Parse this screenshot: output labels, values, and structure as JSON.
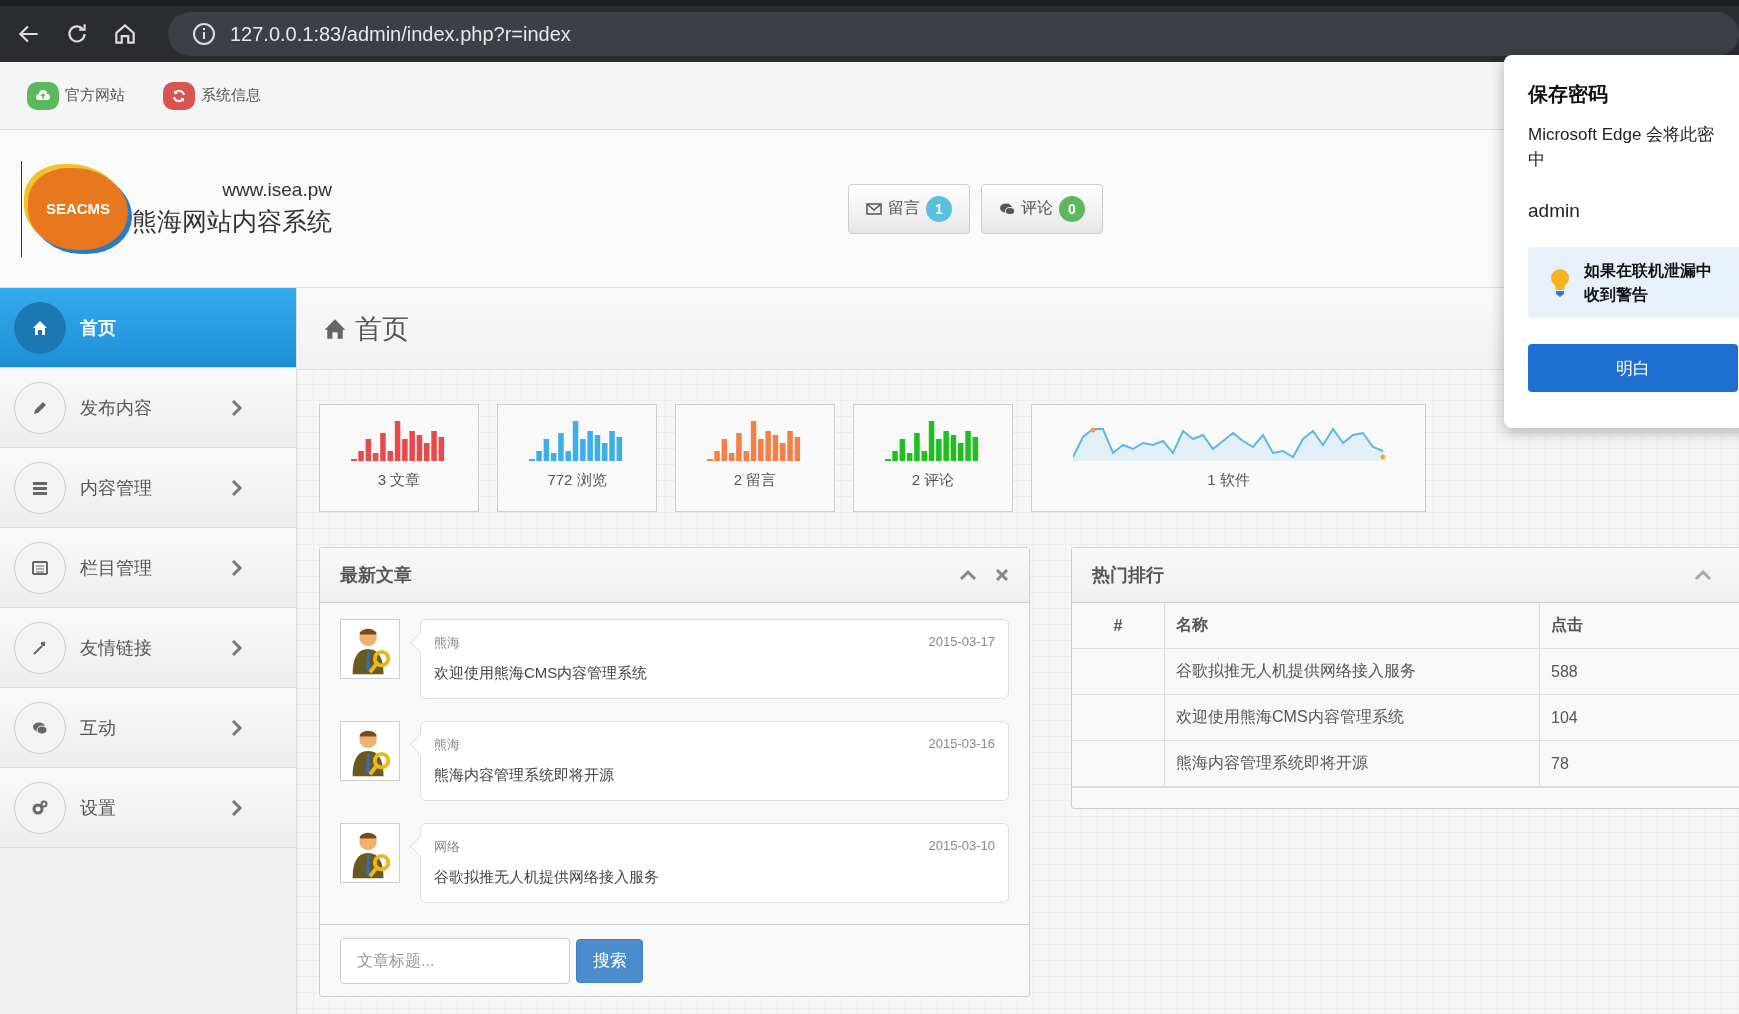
{
  "browser": {
    "url": "127.0.0.1:83/admin/index.php?r=index"
  },
  "top_nav": [
    {
      "label": "官方网站",
      "color": "#5cb85c"
    },
    {
      "label": "系统信息",
      "color": "#d9534f"
    }
  ],
  "header": {
    "logo_text": "SEACMS",
    "site_url": "www.isea.pw",
    "site_name": "熊海网站内容系统",
    "buttons": [
      {
        "label": "留言",
        "count": "1",
        "color": "#5bc0de"
      },
      {
        "label": "评论",
        "count": "0",
        "color": "#5cb85c"
      }
    ]
  },
  "sidebar": {
    "items": [
      {
        "label": "首页",
        "selected": true
      },
      {
        "label": "发布内容",
        "selected": false
      },
      {
        "label": "内容管理",
        "selected": false
      },
      {
        "label": "栏目管理",
        "selected": false
      },
      {
        "label": "友情链接",
        "selected": false
      },
      {
        "label": "互动",
        "selected": false
      },
      {
        "label": "设置",
        "selected": false
      }
    ]
  },
  "page_title": "首页",
  "stats": [
    {
      "kind": "bars",
      "label": "3 文章",
      "color": "#e84a4a"
    },
    {
      "kind": "bars",
      "label": "772 浏览",
      "color": "#3daee9"
    },
    {
      "kind": "bars",
      "label": "2 留言",
      "color": "#f57f46"
    },
    {
      "kind": "bars",
      "label": "2 评论",
      "color": "#1fbf1f"
    },
    {
      "kind": "line",
      "label": "1 软件",
      "color": "#5bb8e6"
    }
  ],
  "latest_articles": {
    "title": "最新文章",
    "items": [
      {
        "author": "熊海",
        "date": "2015-03-17",
        "title": "欢迎使用熊海CMS内容管理系统"
      },
      {
        "author": "熊海",
        "date": "2015-03-16",
        "title": "熊海内容管理系统即将开源"
      },
      {
        "author": "网络",
        "date": "2015-03-10",
        "title": "谷歌拟推无人机提供网络接入服务"
      }
    ],
    "search": {
      "placeholder": "文章标题...",
      "button": "搜索"
    }
  },
  "ranking": {
    "title": "热门排行",
    "columns": [
      "#",
      "名称",
      "点击"
    ],
    "rows": [
      {
        "name": "谷歌拟推无人机提供网络接入服务",
        "hits": "588"
      },
      {
        "name": "欢迎使用熊海CMS内容管理系统",
        "hits": "104"
      },
      {
        "name": "熊海内容管理系统即将开源",
        "hits": "78"
      }
    ]
  },
  "password_popup": {
    "title": "保存密码",
    "message_lines": [
      "Microsoft Edge 会将此密",
      "中"
    ],
    "username": "admin",
    "tip_lines": [
      "如果在联机泄漏中",
      "收到警告"
    ],
    "button": "明白"
  }
}
